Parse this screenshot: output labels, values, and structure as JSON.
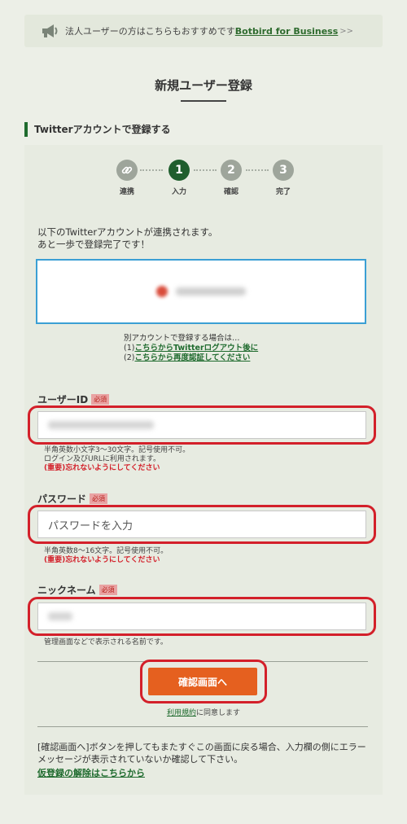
{
  "banner": {
    "text": "法人ユーザーの方はこちらもおすすめです",
    "link": "Botbird for Business",
    "arrow": ">>"
  },
  "page_title": "新規ユーザー登録",
  "section_heading": "Twitterアカウントで登録する",
  "steps": [
    {
      "num": "",
      "label": "連携",
      "icon": "link-icon"
    },
    {
      "num": "1",
      "label": "入力"
    },
    {
      "num": "2",
      "label": "確認"
    },
    {
      "num": "3",
      "label": "完了"
    }
  ],
  "info": {
    "line1": "以下のTwitterアカウントが連携されます。",
    "line2": "あと一歩で登録完了です！"
  },
  "alt": {
    "intro": "別アカウントで登録する場合は…",
    "option1_prefix": "(1)",
    "option1_link": "こちらからTwitterログアウト後に",
    "option2_prefix": "(2)",
    "option2_link": "こちらから再度認証してください"
  },
  "fields": {
    "user_id": {
      "label": "ユーザーID",
      "required": "必須",
      "hint1": "半角英数小文字3〜30文字。記号使用不可。",
      "hint2": "ログイン及びURLに利用されます。",
      "warn": "(重要)忘れないようにしてください"
    },
    "password": {
      "label": "パスワード",
      "required": "必須",
      "placeholder": "パスワードを入力",
      "hint1": "半角英数8〜16文字。記号使用不可。",
      "warn": "(重要)忘れないようにしてください"
    },
    "nickname": {
      "label": "ニックネーム",
      "required": "必須",
      "hint1": "管理画面などで表示される名前です。"
    }
  },
  "confirm_button": "確認画面へ",
  "terms": {
    "link": "利用規約",
    "suffix": "に同意します"
  },
  "bottom": {
    "note": "[確認画面へ]ボタンを押してもまたすぐこの画面に戻る場合、入力欄の側にエラーメッセージが表示されていないか確認して下さい。",
    "link": "仮登録の解除はこちらから"
  },
  "colors": {
    "accent_green": "#1f5e2d",
    "button_orange": "#e5601f",
    "highlight_red": "#d3202a",
    "focus_blue": "#3b9fd4"
  }
}
